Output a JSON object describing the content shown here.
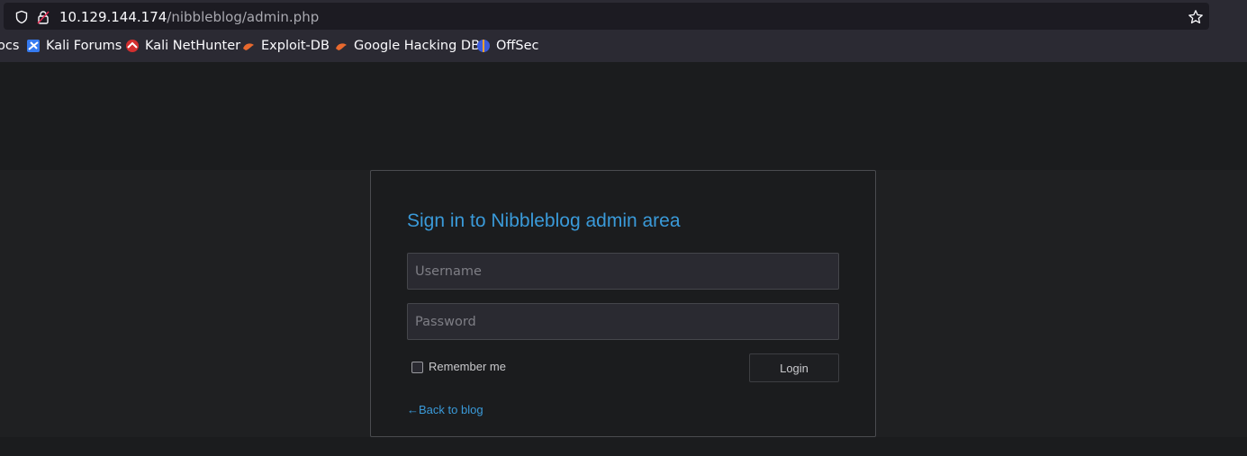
{
  "browser": {
    "url_host": "10.129.144.174",
    "url_path": "/nibbleblog/admin.php",
    "icons": [
      "shield-icon",
      "insecure-lock-icon",
      "bookmark-star-icon"
    ]
  },
  "bookmarks": [
    {
      "label": "ocs",
      "icon": "none"
    },
    {
      "label": "Kali Forums",
      "icon": "kali-forums-icon"
    },
    {
      "label": "Kali NetHunter",
      "icon": "nethunter-icon"
    },
    {
      "label": "Exploit-DB",
      "icon": "exploit-db-icon"
    },
    {
      "label": "Google Hacking DB",
      "icon": "ghdb-icon"
    },
    {
      "label": "OffSec",
      "icon": "offsec-icon"
    }
  ],
  "login": {
    "title": "Sign in to Nibbleblog admin area",
    "username_placeholder": "Username",
    "password_placeholder": "Password",
    "remember_label": "Remember me",
    "remember_checked": false,
    "login_label": "Login",
    "back_link": "←Back to blog"
  },
  "colors": {
    "accent": "#3a9ad9",
    "page_bg": "#1b1c1e",
    "chrome_bg": "#2b2a33"
  }
}
